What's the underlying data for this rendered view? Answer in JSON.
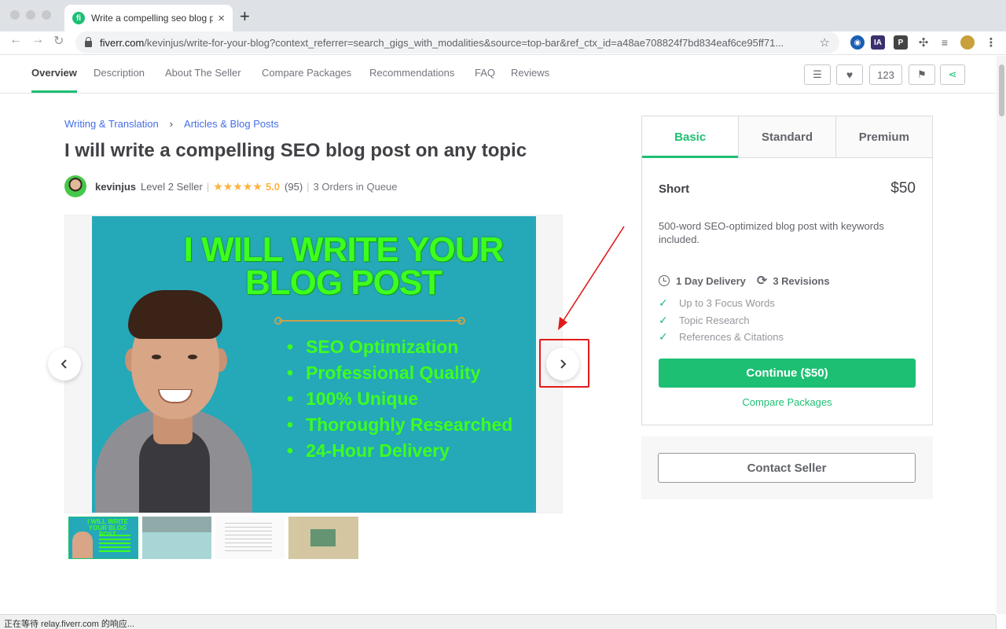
{
  "browser": {
    "tab_title": "Write a compelling seo blog post on any topic",
    "favicon": "fi",
    "url_host": "fiverr.com",
    "url_path": "/kevinjus/write-for-your-blog?context_referrer=search_gigs_with_modalities&source=top-bar&ref_ctx_id=a48ae708824f7bd834eaf6ce95ff71...",
    "extensions": [
      "IA",
      "P"
    ]
  },
  "gig_nav": {
    "items": [
      "Overview",
      "Description",
      "About The Seller",
      "Compare Packages",
      "Recommendations",
      "FAQ",
      "Reviews"
    ],
    "like_count": "123"
  },
  "breadcrumb": {
    "category": "Writing & Translation",
    "subcategory": "Articles & Blog Posts"
  },
  "gig": {
    "title": "I will write a compelling SEO blog post on any topic",
    "seller_name": "kevinjus",
    "seller_level": "Level 2 Seller",
    "stars": "★★★★★",
    "rating": "5.0",
    "review_count": "(95)",
    "queue": "3 Orders in Queue"
  },
  "slide": {
    "headline_1": "I WILL WRITE YOUR",
    "headline_2": "BLOG POST",
    "bullets": [
      "SEO Optimization",
      "Professional Quality",
      "100% Unique",
      "Thoroughly Researched",
      "24-Hour Delivery"
    ]
  },
  "packages": {
    "tabs": [
      "Basic",
      "Standard",
      "Premium"
    ],
    "active_tab": "Basic",
    "name": "Short",
    "price": "$50",
    "description": "500-word SEO-optimized blog post with keywords included.",
    "delivery": "1 Day Delivery",
    "revisions": "3 Revisions",
    "features": [
      "Up to 3 Focus Words",
      "Topic Research",
      "References & Citations"
    ],
    "continue_label": "Continue ($50)",
    "compare_label": "Compare Packages"
  },
  "contact": {
    "label": "Contact Seller"
  },
  "status_bar": "正在等待 relay.fiverr.com 的响应...",
  "colors": {
    "brand_green": "#1dbf73",
    "slide_bg": "#25a8b8",
    "slide_text": "#3dff1e",
    "star": "#ffb33e",
    "annotation_red": "#e01b1b"
  }
}
